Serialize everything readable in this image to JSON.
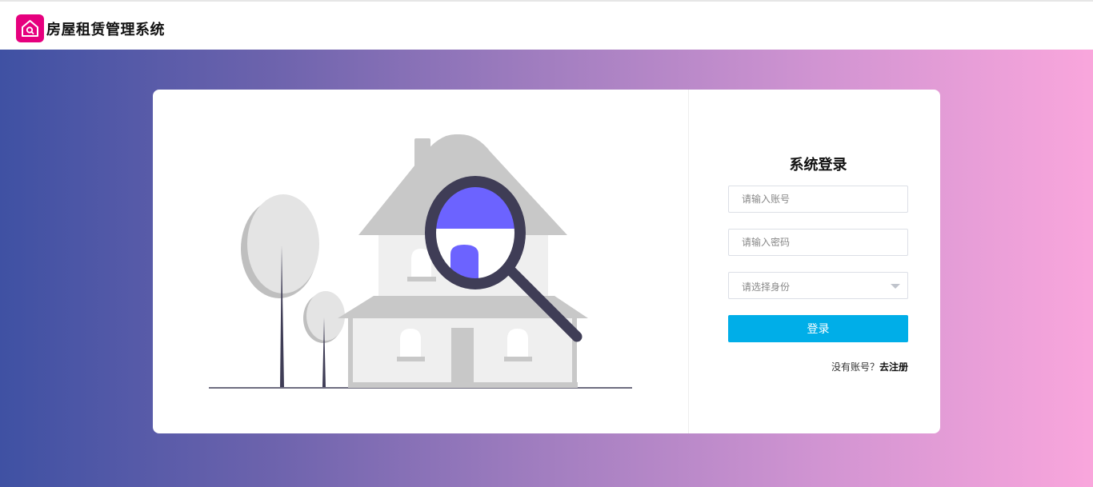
{
  "app": {
    "title": "房屋租赁管理系统",
    "logo_icon": "house-search-icon",
    "brand_color": "#e6007e"
  },
  "login": {
    "title": "系统登录",
    "account_placeholder": "请输入账号",
    "password_placeholder": "请输入密码",
    "role_placeholder": "请选择身份",
    "submit_label": "登录",
    "no_account_text": "没有账号？",
    "register_link": "去注册",
    "button_color": "#00aee8"
  },
  "hero": {
    "gradient_start": "#3f51a3",
    "gradient_end": "#f9a6dc"
  }
}
